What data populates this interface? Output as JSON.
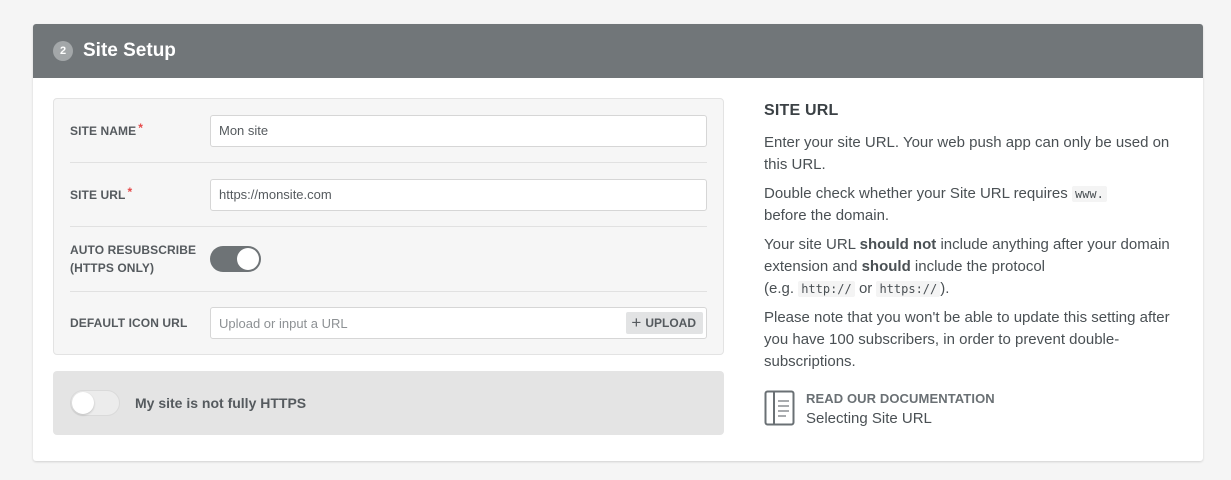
{
  "header": {
    "step_number": "2",
    "title": "Site Setup"
  },
  "form": {
    "site_name": {
      "label": "SITE NAME",
      "required_mark": "*",
      "value": "Mon site"
    },
    "site_url": {
      "label": "SITE URL",
      "required_mark": "*",
      "value": "https://monsite.com"
    },
    "auto_resubscribe": {
      "label_line1": "AUTO RESUBSCRIBE",
      "label_line2": "(HTTPS ONLY)",
      "enabled": true
    },
    "default_icon_url": {
      "label": "DEFAULT ICON URL",
      "placeholder": "Upload or input a URL",
      "upload_label": "UPLOAD"
    }
  },
  "https_toggle": {
    "label": "My site is not fully HTTPS",
    "enabled": false
  },
  "help": {
    "title": "SITE URL",
    "p1": "Enter your site URL. Your web push app can only be used on this URL.",
    "p2_before": "Double check whether your Site URL requires",
    "p2_code": "www.",
    "p2_after": "before the domain.",
    "p3_a": "Your site URL",
    "p3_b": "should not",
    "p3_c": "include anything after your domain extension and",
    "p3_d": "should",
    "p3_e": "include the protocol",
    "p3_f": "(e.g.",
    "p3_code1": "http://",
    "p3_or": "or",
    "p3_code2": "https://",
    "p3_end": ").",
    "p4": "Please note that you won't be able to update this setting after you have 100 subscribers, in order to prevent double-subscriptions.",
    "doc_heading": "READ OUR DOCUMENTATION",
    "doc_link": "Selecting Site URL"
  }
}
